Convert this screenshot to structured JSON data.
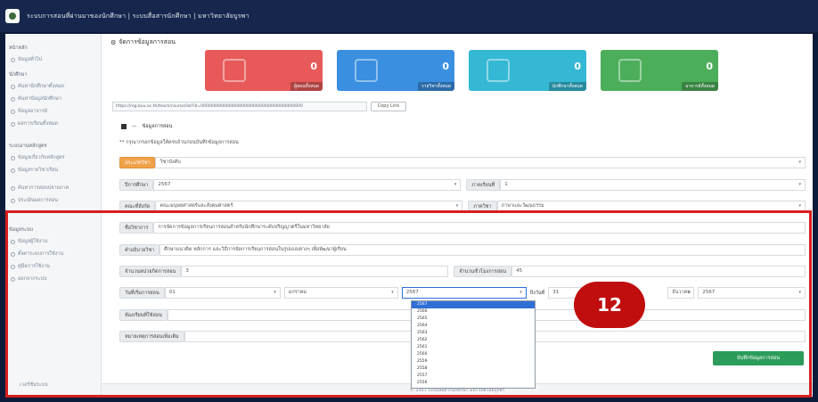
{
  "app": {
    "title": "ระบบการสอนที่ผ่านมาของนักศึกษา | ระบบสื่อสารนักศึกษา | มหาวิทยาลัยบูรพา"
  },
  "sidebar": {
    "groups": [
      {
        "label": "หน้าหลัก",
        "items": [
          "ข้อมูลทั่วไป"
        ]
      },
      {
        "label": "นักศึกษา",
        "items": [
          "ค้นหานักศึกษาทั้งหมด",
          "ค้นหาข้อมูลนักศึกษา",
          "ข้อมูลอาจารย์",
          "ผลการเรียนทั้งหมด"
        ]
      },
      {
        "label": "ระบบงานหลักสูตร",
        "items": [
          "ข้อมูลเกี่ยวกับหลักสูตร",
          "ข้อมูลรายวิชาเรียน"
        ]
      },
      {
        "label": "",
        "items": [
          "ค้นหาการสอบปลายภาค",
          "ประเมินผลการสอน"
        ]
      },
      {
        "label": "ข้อมูลระบบ",
        "items": [
          "ข้อมูลผู้ใช้งาน",
          "ตั้งค่าระบบการใช้งาน",
          "คู่มือการใช้งาน",
          "ออกจากระบบ"
        ]
      }
    ],
    "footer": "เวอร์ชันระบบ"
  },
  "page": {
    "heading": "จัดการข้อมูลการสอน"
  },
  "cards": [
    {
      "value": "0",
      "label": "ผู้สอนทั้งหมด",
      "color": "#e85a5a"
    },
    {
      "value": "0",
      "label": "รายวิชาทั้งหมด",
      "color": "#3a8fe0"
    },
    {
      "value": "0",
      "label": "นักศึกษาทั้งหมด",
      "color": "#35b8d4"
    },
    {
      "value": "0",
      "label": "อาจารย์ทั้งหมด",
      "color": "#4cae5a"
    }
  ],
  "url_bar": {
    "value": "https://reg.buu.ac.th/teach/course/list?id=0000000000000000000000000000000000000000",
    "copy_label": "Copy Link"
  },
  "tabs": {
    "items": [
      "ข้อมูลการสอน"
    ]
  },
  "form": {
    "note": "** กรุณากรอกข้อมูลให้ครบถ้วนก่อนบันทึกข้อมูลการสอน",
    "course_type": {
      "label": "ประเภทวิชา",
      "value": "วิชาบังคับ"
    },
    "semester": {
      "label": "ปีการศึกษา",
      "value": "2567"
    },
    "term": {
      "label": "ภาคเรียนที่",
      "value": "1"
    },
    "faculty": {
      "label": "คณะที่สังกัด",
      "value": "คณะมนุษยศาสตร์และสังคมศาสตร์"
    },
    "department": {
      "label": "ภาควิชา",
      "value": "ภาษาและวัฒนธรรม"
    },
    "course_name": {
      "label": "ชื่อวิชาการ",
      "value": "การจัดการข้อมูลการเรียนการสอนสำหรับนักศึกษาระดับปริญญาตรีในมหาวิทยาลัย"
    },
    "course_desc": {
      "label": "คำอธิบายวิชา",
      "value": "ศึกษาแนวคิด หลักการ และวิธีการจัดการเรียนการสอนในรูปแบบต่างๆ เพื่อพัฒนาผู้เรียน"
    },
    "credits": {
      "label": "จำนวนหน่วยกิตการสอน",
      "value": "3"
    },
    "hours": {
      "label": "จำนวนชั่วโมงการสอน",
      "value": "45"
    },
    "date_label": "วันที่เริ่มการสอน",
    "day": "01",
    "month": "มกราคม",
    "year": "2567",
    "end_label": "ถึงวันที่",
    "end_day": "31",
    "end_month": "ธันวาคม",
    "end_year": "2567",
    "room": {
      "label": "ห้องเรียนที่ใช้สอน",
      "value": ""
    },
    "remark": {
      "label": "หมายเหตุการสอนเพิ่มเติม",
      "value": ""
    },
    "save_label": "บันทึกข้อมูลการสอน"
  },
  "year_dropdown": {
    "options": [
      "2567",
      "2566",
      "2565",
      "2564",
      "2563",
      "2562",
      "2561",
      "2560",
      "2559",
      "2558",
      "2557",
      "2556"
    ],
    "selected_index": 0
  },
  "annotation": {
    "step": "12"
  },
  "footer": {
    "text": "© 2567 ระบบสื่อสารนักศึกษา มหาวิทยาลัยบูรพา"
  }
}
